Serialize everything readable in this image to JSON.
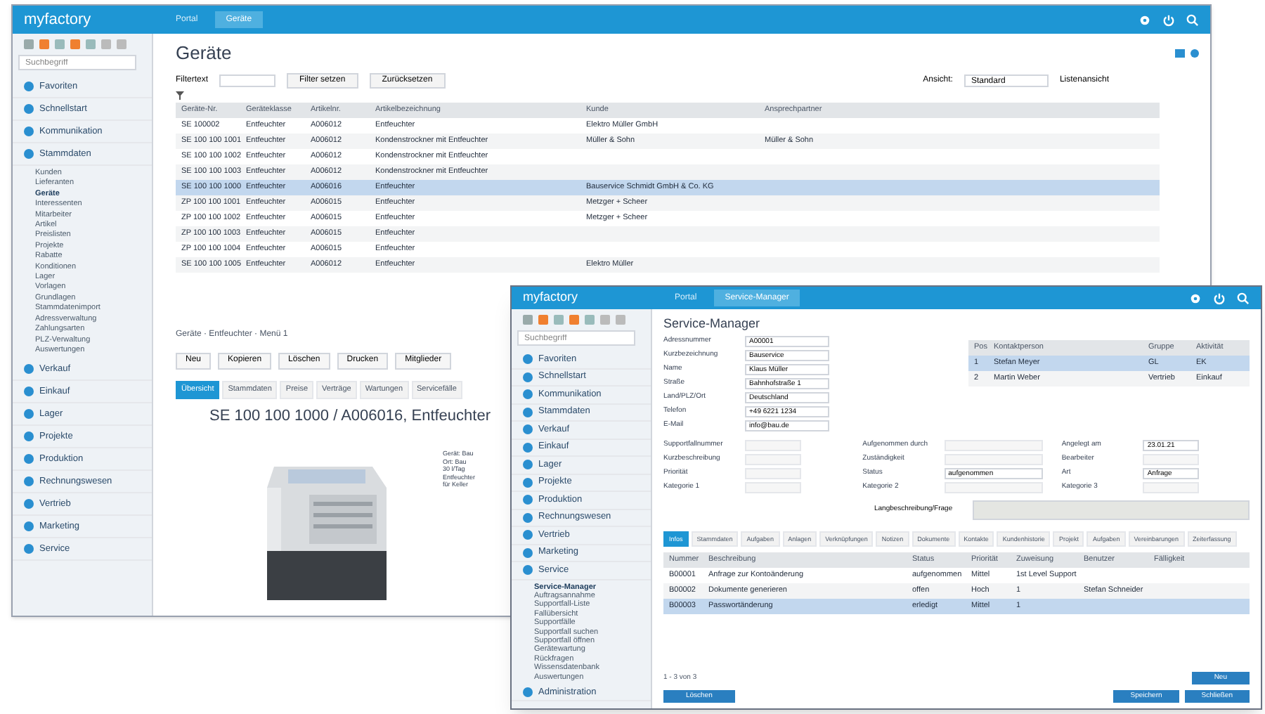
{
  "back": {
    "logo": "myfactory",
    "tabs": [
      {
        "label": "Portal",
        "selected": false
      },
      {
        "label": "Geräte",
        "selected": true
      }
    ],
    "sidebar": {
      "search_placeholder": "Suchbegriff",
      "sections": [
        {
          "label": "Favoriten"
        },
        {
          "label": "Schnellstart"
        },
        {
          "label": "Kommunikation"
        },
        {
          "label": "Stammdaten",
          "children": [
            {
              "label": "Kunden",
              "selected": false
            },
            {
              "label": "Lieferanten",
              "selected": false
            },
            {
              "label": "Geräte",
              "selected": true
            },
            {
              "label": "Interessenten",
              "selected": false
            },
            {
              "label": "Mitarbeiter",
              "selected": false
            },
            {
              "label": "Artikel",
              "selected": false
            },
            {
              "label": "Preislisten",
              "selected": false
            },
            {
              "label": "Projekte",
              "selected": false
            },
            {
              "label": "Rabatte",
              "selected": false
            },
            {
              "label": "Konditionen",
              "selected": false
            },
            {
              "label": "Lager",
              "selected": false
            },
            {
              "label": "Vorlagen",
              "selected": false
            },
            {
              "label": "Grundlagen",
              "selected": false
            },
            {
              "label": "Stammdatenimport",
              "selected": false
            },
            {
              "label": "Adressverwaltung",
              "selected": false
            },
            {
              "label": "Zahlungsarten",
              "selected": false
            },
            {
              "label": "PLZ-Verwaltung",
              "selected": false
            },
            {
              "label": "Auswertungen",
              "selected": false
            }
          ]
        },
        {
          "label": "Verkauf"
        },
        {
          "label": "Einkauf"
        },
        {
          "label": "Lager"
        },
        {
          "label": "Projekte"
        },
        {
          "label": "Produktion"
        },
        {
          "label": "Rechnungswesen"
        },
        {
          "label": "Vertrieb"
        },
        {
          "label": "Marketing"
        },
        {
          "label": "Service"
        }
      ]
    },
    "title": "Geräte",
    "filter_label": "Filtertext",
    "buttons": [
      "Filter setzen",
      "Zurücksetzen"
    ],
    "view_label": "Ansicht:",
    "view_value": "Standard",
    "view_mode": "Listenansicht",
    "table": {
      "columns": [
        "Geräte-Nr.",
        "Geräteklasse",
        "Artikelnr.",
        "Artikelbezeichnung",
        "Kunde",
        "Ansprechpartner"
      ],
      "rows": [
        {
          "cells": [
            "SE 100002",
            "Entfeuchter",
            "A006012",
            "Entfeuchter",
            "Elektro Müller GmbH",
            ""
          ],
          "selected": false
        },
        {
          "cells": [
            "SE 100 100 1001",
            "Entfeuchter",
            "A006012",
            "Kondenstrockner mit Entfeuchter",
            "Müller & Sohn",
            "Müller & Sohn"
          ],
          "selected": false
        },
        {
          "cells": [
            "SE 100 100 1002",
            "Entfeuchter",
            "A006012",
            "Kondenstrockner mit Entfeuchter",
            "",
            ""
          ],
          "selected": false
        },
        {
          "cells": [
            "SE 100 100 1003",
            "Entfeuchter",
            "A006012",
            "Kondenstrockner mit Entfeuchter",
            "",
            ""
          ],
          "selected": false
        },
        {
          "cells": [
            "SE 100 100 1000",
            "Entfeuchter",
            "A006016",
            "Entfeuchter",
            "Bauservice Schmidt GmbH & Co. KG",
            ""
          ],
          "selected": true
        },
        {
          "cells": [
            "ZP 100 100 1001",
            "Entfeuchter",
            "A006015",
            "Entfeuchter",
            "Metzger + Scheer",
            ""
          ],
          "selected": false
        },
        {
          "cells": [
            "ZP 100 100 1002",
            "Entfeuchter",
            "A006015",
            "Entfeuchter",
            "Metzger + Scheer",
            ""
          ],
          "selected": false
        },
        {
          "cells": [
            "ZP 100 100 1003",
            "Entfeuchter",
            "A006015",
            "Entfeuchter",
            "",
            ""
          ],
          "selected": false
        },
        {
          "cells": [
            "ZP 100 100 1004",
            "Entfeuchter",
            "A006015",
            "Entfeuchter",
            "",
            ""
          ],
          "selected": false
        },
        {
          "cells": [
            "SE 100 100 1005",
            "Entfeuchter",
            "A006012",
            "Entfeuchter",
            "Elektro Müller",
            ""
          ],
          "selected": false
        }
      ]
    },
    "breadcrumb": "Geräte · Entfeuchter · Menü 1",
    "actions": [
      "Neu",
      "Kopieren",
      "Löschen",
      "Drucken",
      "Mitglieder"
    ],
    "detail_tabs": [
      {
        "label": "Übersicht",
        "selected": true
      },
      {
        "label": "Stammdaten",
        "selected": false
      },
      {
        "label": "Preise",
        "selected": false
      },
      {
        "label": "Verträge",
        "selected": false
      },
      {
        "label": "Wartungen",
        "selected": false
      },
      {
        "label": "Servicefälle",
        "selected": false
      }
    ],
    "device_title": "SE 100 100 1000 / A006016, Entfeuchter",
    "device_notes": [
      "Gerät: Bau",
      "Ort: Bau",
      "30 l/Tag",
      "Entfeuchter",
      "für Keller"
    ]
  },
  "front": {
    "logo": "myfactory",
    "tabs": [
      {
        "label": "Portal",
        "selected": false
      },
      {
        "label": "Service-Manager",
        "selected": true
      }
    ],
    "sidebar": {
      "search_placeholder": "Suchbegriff",
      "sections": [
        {
          "label": "Favoriten"
        },
        {
          "label": "Schnellstart"
        },
        {
          "label": "Kommunikation"
        },
        {
          "label": "Stammdaten"
        },
        {
          "label": "Verkauf"
        },
        {
          "label": "Einkauf"
        },
        {
          "label": "Lager"
        },
        {
          "label": "Projekte"
        },
        {
          "label": "Produktion"
        },
        {
          "label": "Rechnungswesen"
        },
        {
          "label": "Vertrieb"
        },
        {
          "label": "Marketing"
        },
        {
          "label": "Service",
          "children": [
            {
              "label": "Service-Manager",
              "selected": true
            },
            {
              "label": "Auftragsannahme",
              "selected": false
            },
            {
              "label": "Supportfall-Liste",
              "selected": false
            },
            {
              "label": "Fallübersicht",
              "selected": false
            },
            {
              "label": "Supportfälle",
              "selected": false
            },
            {
              "label": "Supportfall suchen",
              "selected": false
            },
            {
              "label": "Supportfall öffnen",
              "selected": false
            },
            {
              "label": "Gerätewartung",
              "selected": false
            },
            {
              "label": "Rückfragen",
              "selected": false
            },
            {
              "label": "Wissensdatenbank",
              "selected": false
            },
            {
              "label": "Auswertungen",
              "selected": false
            }
          ]
        },
        {
          "label": "Administration"
        }
      ]
    },
    "title": "Service-Manager",
    "address_fields": [
      {
        "label": "Adressnummer",
        "value": "A00001"
      },
      {
        "label": "Kurzbezeichnung",
        "value": "Bauservice"
      },
      {
        "label": "Name",
        "value": "Klaus Müller"
      },
      {
        "label": "Straße",
        "value": "Bahnhofstraße 1"
      },
      {
        "label": "Land/PLZ/Ort",
        "value": "Deutschland"
      },
      {
        "label": "Telefon",
        "value": "+49 6221 1234"
      },
      {
        "label": "E-Mail",
        "value": "info@bau.de"
      }
    ],
    "contacts": {
      "columns": [
        "Pos",
        "Kontaktperson",
        "Gruppe",
        "Aktivität"
      ],
      "rows": [
        {
          "cells": [
            "1",
            "Stefan Meyer",
            "GL",
            "EK"
          ],
          "selected": true
        },
        {
          "cells": [
            "2",
            "Martin Weber",
            "Vertrieb",
            "Einkauf"
          ],
          "selected": false
        }
      ]
    },
    "case_fields": [
      {
        "label": "Supportfallnummer"
      },
      {
        "label": "Kurzbeschreibung"
      },
      {
        "label": "Priorität"
      },
      {
        "label": "Kategorie 1"
      },
      {
        "label": "Aufgenommen durch"
      },
      {
        "label": "Zuständigkeit"
      },
      {
        "label": "Status",
        "value": "aufgenommen"
      },
      {
        "label": "Kategorie 2"
      },
      {
        "label": "Angelegt am",
        "value": "23.01.21"
      },
      {
        "label": "Bearbeiter"
      },
      {
        "label": "Art",
        "value": "Anfrage"
      },
      {
        "label": "Kategorie 3"
      }
    ],
    "long_label": "Langbeschreibung/Frage",
    "detail_tabs": [
      {
        "label": "Infos",
        "selected": true
      },
      {
        "label": "Stammdaten",
        "selected": false
      },
      {
        "label": "Aufgaben",
        "selected": false
      },
      {
        "label": "Anlagen",
        "selected": false
      },
      {
        "label": "Verknüpfungen",
        "selected": false
      },
      {
        "label": "Notizen",
        "selected": false
      },
      {
        "label": "Dokumente",
        "selected": false
      },
      {
        "label": "Kontakte",
        "selected": false
      },
      {
        "label": "Kundenhistorie",
        "selected": false
      },
      {
        "label": "Projekt",
        "selected": false
      },
      {
        "label": "Aufgaben",
        "selected": false
      },
      {
        "label": "Vereinbarungen",
        "selected": false
      },
      {
        "label": "Zeiterfassung",
        "selected": false
      }
    ],
    "table": {
      "columns": [
        "Nummer",
        "Beschreibung",
        "Status",
        "Priorität",
        "Zuweisung",
        "Benutzer",
        "Fälligkeit"
      ],
      "rows": [
        {
          "cells": [
            "B00001",
            "Anfrage zur Kontoänderung",
            "aufgenommen",
            "Mittel",
            "1st Level Support",
            "",
            ""
          ],
          "selected": false
        },
        {
          "cells": [
            "B00002",
            "Dokumente generieren",
            "offen",
            "Hoch",
            "1",
            "Stefan Schneider",
            ""
          ],
          "selected": false
        },
        {
          "cells": [
            "B00003",
            "Passwortänderung",
            "erledigt",
            "Mittel",
            "1",
            "",
            ""
          ],
          "selected": true
        }
      ]
    },
    "pager": "1 - 3 von 3",
    "new_button": "Neu",
    "left_button": "Löschen",
    "right_buttons": [
      "Speichern",
      "Schließen"
    ]
  }
}
